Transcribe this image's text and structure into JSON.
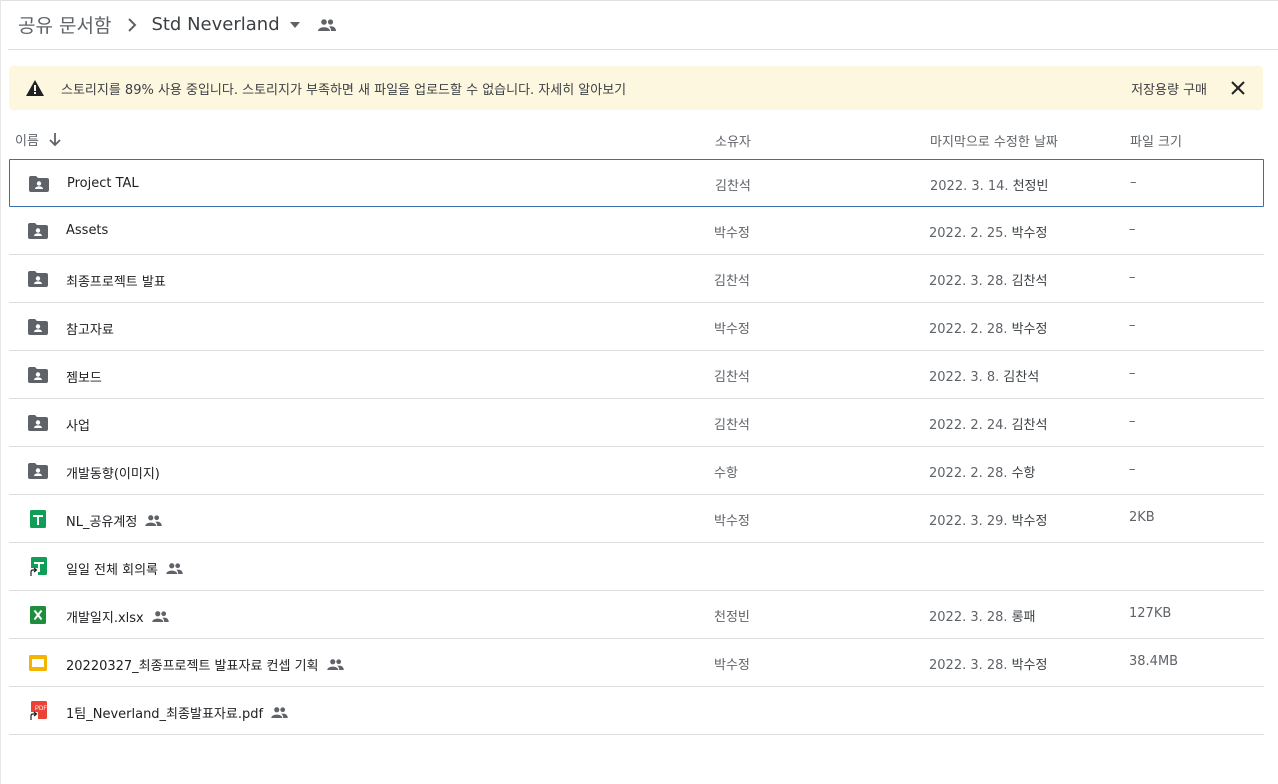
{
  "breadcrumb": {
    "root": "공유 문서함",
    "current": "Std Neverland"
  },
  "banner": {
    "message": "스토리지를 89% 사용 중입니다. 스토리지가 부족하면 새 파일을 업로드할 수 없습니다. 자세히 알아보기",
    "buy_label": "저장용량 구매"
  },
  "columns": {
    "name": "이름",
    "owner": "소유자",
    "modified": "마지막으로 수정한 날짜",
    "size": "파일 크기"
  },
  "files": [
    {
      "name": "Project TAL",
      "icon": "shared-folder-icon",
      "shared": false,
      "owner": "김찬석",
      "date": "2022. 3. 14.",
      "by": "천정빈",
      "size": "–"
    },
    {
      "name": "Assets",
      "icon": "shared-folder-icon",
      "shared": false,
      "owner": "박수정",
      "date": "2022. 2. 25.",
      "by": "박수정",
      "size": "–"
    },
    {
      "name": "최종프로젝트 발표",
      "icon": "shared-folder-icon",
      "shared": false,
      "owner": "김찬석",
      "date": "2022. 3. 28.",
      "by": "김찬석",
      "size": "–"
    },
    {
      "name": "참고자료",
      "icon": "shared-folder-icon",
      "shared": false,
      "owner": "박수정",
      "date": "2022. 2. 28.",
      "by": "박수정",
      "size": "–"
    },
    {
      "name": "젬보드",
      "icon": "shared-folder-icon",
      "shared": false,
      "owner": "김찬석",
      "date": "2022. 3. 8.",
      "by": "김찬석",
      "size": "–"
    },
    {
      "name": "사업",
      "icon": "shared-folder-icon",
      "shared": false,
      "owner": "김찬석",
      "date": "2022. 2. 24.",
      "by": "김찬석",
      "size": "–"
    },
    {
      "name": "개발동향(이미지)",
      "icon": "shared-folder-icon",
      "shared": false,
      "owner": "수항",
      "date": "2022. 2. 28.",
      "by": "수항",
      "size": "–"
    },
    {
      "name": "NL_공유계정",
      "icon": "sheets-icon",
      "shared": true,
      "owner": "박수정",
      "date": "2022. 3. 29.",
      "by": "박수정",
      "size": "2KB"
    },
    {
      "name": "일일 전체 회의록",
      "icon": "sheets-shortcut-icon",
      "shared": true,
      "owner": "",
      "date": "",
      "by": "",
      "size": ""
    },
    {
      "name": "개발일지.xlsx",
      "icon": "excel-icon",
      "shared": true,
      "owner": "천정빈",
      "date": "2022. 3. 28.",
      "by": "롱패",
      "size": "127KB"
    },
    {
      "name": "20220327_최종프로젝트 발표자료  컨셉 기획",
      "icon": "slides-icon",
      "shared": true,
      "owner": "박수정",
      "date": "2022. 3. 28.",
      "by": "박수정",
      "size": "38.4MB"
    },
    {
      "name": "1팀_Neverland_최종발표자료.pdf",
      "icon": "pdf-shortcut-icon",
      "shared": true,
      "owner": "",
      "date": "",
      "by": "",
      "size": ""
    }
  ],
  "colors": {
    "banner_bg": "#fef7e0",
    "selected_border": "#3c6fb0",
    "sheets_green": "#0f9d58",
    "excel_green": "#1e8e3e",
    "slides_yellow": "#f4b400",
    "pdf_red": "#ea4335",
    "folder_gray": "#5f6368"
  }
}
